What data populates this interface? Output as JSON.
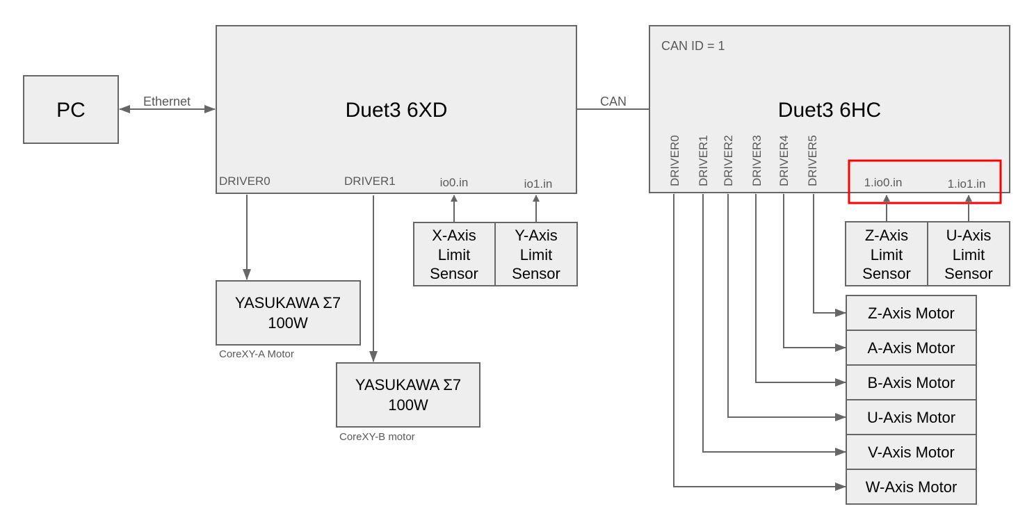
{
  "pc": {
    "label": "PC"
  },
  "links": {
    "ethernet": "Ethernet",
    "can": "CAN"
  },
  "board_6xd": {
    "title": "Duet3 6XD",
    "ports": {
      "driver0": "DRIVER0",
      "driver1": "DRIVER1",
      "io0": "io0.in",
      "io1": "io1.in"
    }
  },
  "board_6hc": {
    "title": "Duet3 6HC",
    "can_id": "CAN ID = 1",
    "drivers": [
      "DRIVER0",
      "DRIVER1",
      "DRIVER2",
      "DRIVER3",
      "DRIVER4",
      "DRIVER5"
    ],
    "io0": "1.io0.in",
    "io1": "1.io1.in"
  },
  "servo_a": {
    "line1": "YASUKAWA Σ7",
    "line2": "100W",
    "caption": "CoreXY-A Motor"
  },
  "servo_b": {
    "line1": "YASUKAWA Σ7",
    "line2": "100W",
    "caption": "CoreXY-B motor"
  },
  "sensors_6xd": [
    {
      "line1": "X-Axis",
      "line2": "Limit",
      "line3": "Sensor"
    },
    {
      "line1": "Y-Axis",
      "line2": "Limit",
      "line3": "Sensor"
    }
  ],
  "sensors_6hc": [
    {
      "line1": "Z-Axis",
      "line2": "Limit",
      "line3": "Sensor"
    },
    {
      "line1": "U-Axis",
      "line2": "Limit",
      "line3": "Sensor"
    }
  ],
  "motors_6hc": [
    "Z-Axis Motor",
    "A-Axis Motor",
    "B-Axis Motor",
    "U-Axis Motor",
    "V-Axis Motor",
    "W-Axis Motor"
  ],
  "colors": {
    "box_fill": "#eeeeee",
    "stroke": "#666666",
    "highlight": "#ff0000"
  }
}
